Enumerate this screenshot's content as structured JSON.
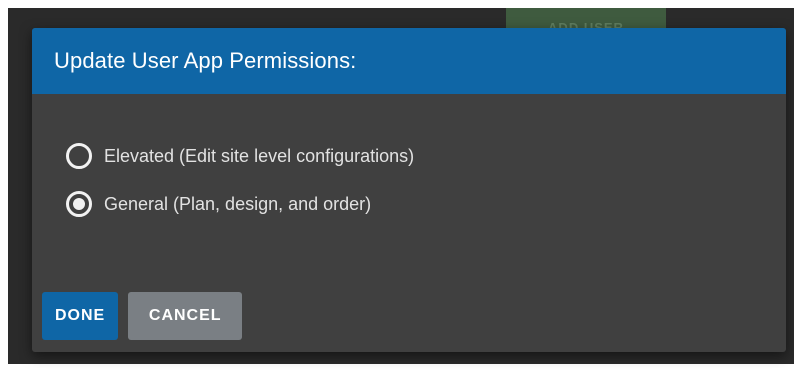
{
  "background": {
    "add_button_label": "ADD USER"
  },
  "dialog": {
    "title": "Update User App Permissions:",
    "options": [
      {
        "label": "Elevated (Edit site level configurations)",
        "selected": false
      },
      {
        "label": "General (Plan, design, and order)",
        "selected": true
      }
    ],
    "buttons": {
      "done": "DONE",
      "cancel": "CANCEL"
    }
  },
  "colors": {
    "header": "#0f66a6",
    "dialog_body": "#404040",
    "done_button": "#0f66a6",
    "cancel_button": "#7a7f84"
  },
  "icons": {
    "unselected": "radio-unchecked-icon",
    "selected": "radio-checked-icon"
  }
}
